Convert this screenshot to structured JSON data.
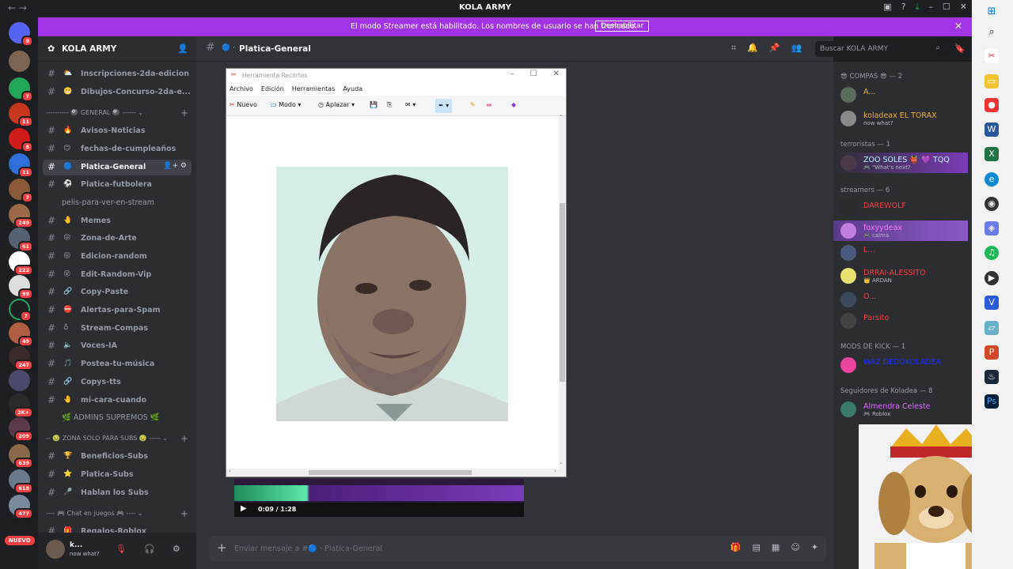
{
  "app": {
    "window_title": "KOLA ARMY"
  },
  "banner": {
    "message": "El modo Streamer está habilitado. Los nombres de usuario se han truncado.",
    "disable_label": "Deshabilitar"
  },
  "servers": {
    "badges": [
      "9",
      "7",
      "11",
      "8",
      "11",
      "7",
      "249",
      "61",
      "222",
      "99",
      "7",
      "49",
      "247",
      "2K+",
      "209",
      "639",
      "618",
      "477"
    ],
    "new_label": "NUEVO"
  },
  "guild": {
    "name": "KOLA ARMY"
  },
  "channels": [
    {
      "emoji": "⛅",
      "name": "Inscripciones-2da-edicion"
    },
    {
      "emoji": "😬",
      "name": "Dibujos-Concurso-2da-e..."
    },
    {
      "category": "---------- 🎱 GENERAL 🎱 ------ ⌄"
    },
    {
      "emoji": "🔥",
      "name": "Avisos-Noticias"
    },
    {
      "emoji": "😊",
      "name": "fechas-de-cumpleaños"
    },
    {
      "emoji": "🔵",
      "name": "Platica-General",
      "active": true
    },
    {
      "emoji": "⚽",
      "name": "Platica-futbolera"
    },
    {
      "plain": "pelis-para-ver-en-stream"
    },
    {
      "emoji": "🤚",
      "name": "Memes"
    },
    {
      "emoji": "😜",
      "name": "Zona-de-Arte"
    },
    {
      "emoji": "😝",
      "name": "Edicion-random"
    },
    {
      "emoji": "😵",
      "name": "Edit-Random-Vip"
    },
    {
      "emoji": "🔗",
      "name": "Copy-Paste"
    },
    {
      "emoji": "⛔",
      "name": "Alertas-para-Spam"
    },
    {
      "emoji": "♁",
      "name": "Stream-Compas"
    },
    {
      "emoji": "🔈",
      "name": "Voces-IA"
    },
    {
      "emoji": "🎵",
      "name": "Postea-tu-música"
    },
    {
      "emoji": "🔗",
      "name": "Copys-tts"
    },
    {
      "emoji": "🤚",
      "name": "mi-cara-cuando"
    },
    {
      "plain": "🌿 ADMINS SUPREMOS 🌿"
    },
    {
      "category": "-- 🤢 ZONA SOLO PARA SUBS 🤢 ----- ⌄"
    },
    {
      "emoji": "🏆",
      "name": "Beneficios-Subs"
    },
    {
      "emoji": "⭐",
      "name": "Platica-Subs"
    },
    {
      "emoji": "🎤",
      "name": "Hablan los Subs"
    },
    {
      "category": "---- 🎮 Chat en juegos 🎮 ---- ⌄"
    },
    {
      "emoji": "🎁",
      "name": "Regalos-Roblox"
    }
  ],
  "user": {
    "name": "k...",
    "status": "now what?"
  },
  "channel_header": {
    "name": "Platica-General",
    "search_placeholder": "Buscar KOLA ARMY"
  },
  "composer": {
    "placeholder_prefix": "Enviar mensaje a #",
    "placeholder_channel": "Platica-General"
  },
  "video": {
    "time": "0:09 / 1:28"
  },
  "snip": {
    "title": "Herramienta Recortes",
    "menu": [
      "Archivo",
      "Edición",
      "Herramientas",
      "Ayuda"
    ],
    "tools": {
      "new": "Nuevo",
      "mode": "Modo",
      "delay": "Aplazar"
    }
  },
  "members": {
    "categories": [
      {
        "label": "😎 COMPAS 😎 — 2"
      },
      {
        "label": "terroristas — 1"
      },
      {
        "label": "streamers — 6"
      },
      {
        "label": "MODS DE KICK — 1"
      },
      {
        "label": "Seguidores de Koladea — 8"
      }
    ],
    "list": [
      {
        "name": "A...",
        "sub": "",
        "color": "#f0b232"
      },
      {
        "name": "koladeax EL TORAX",
        "sub": "now what?",
        "color": "#f0b232"
      },
      {
        "name": "ZOO SOLES 👹 💜 TQQ",
        "sub": "🎮 \"What's next?",
        "color": "#b9f2ff"
      },
      {
        "name": "DAREWOLF",
        "sub": "",
        "color": "#f23f43"
      },
      {
        "name": "foxyydeax",
        "sub": "🎮 calma",
        "color": "#ff73fa"
      },
      {
        "name": "L...",
        "sub": "",
        "color": "#f23f43"
      },
      {
        "name": "DRRAI-ALESSITO",
        "sub": "👑 ARDAN",
        "color": "#f23f43"
      },
      {
        "name": "O...",
        "sub": "",
        "color": "#f23f43"
      },
      {
        "name": "Parsito",
        "sub": "",
        "color": "#f23f43"
      },
      {
        "name": "WAZ DEDOKOLADEA",
        "sub": "",
        "color": "#1f2dff"
      },
      {
        "name": "Almendra Celeste",
        "sub": "🎮 Roblox",
        "color": "#e070ff"
      }
    ]
  },
  "colors": {
    "banner": "#a333e6",
    "accent": "#5865f2"
  }
}
